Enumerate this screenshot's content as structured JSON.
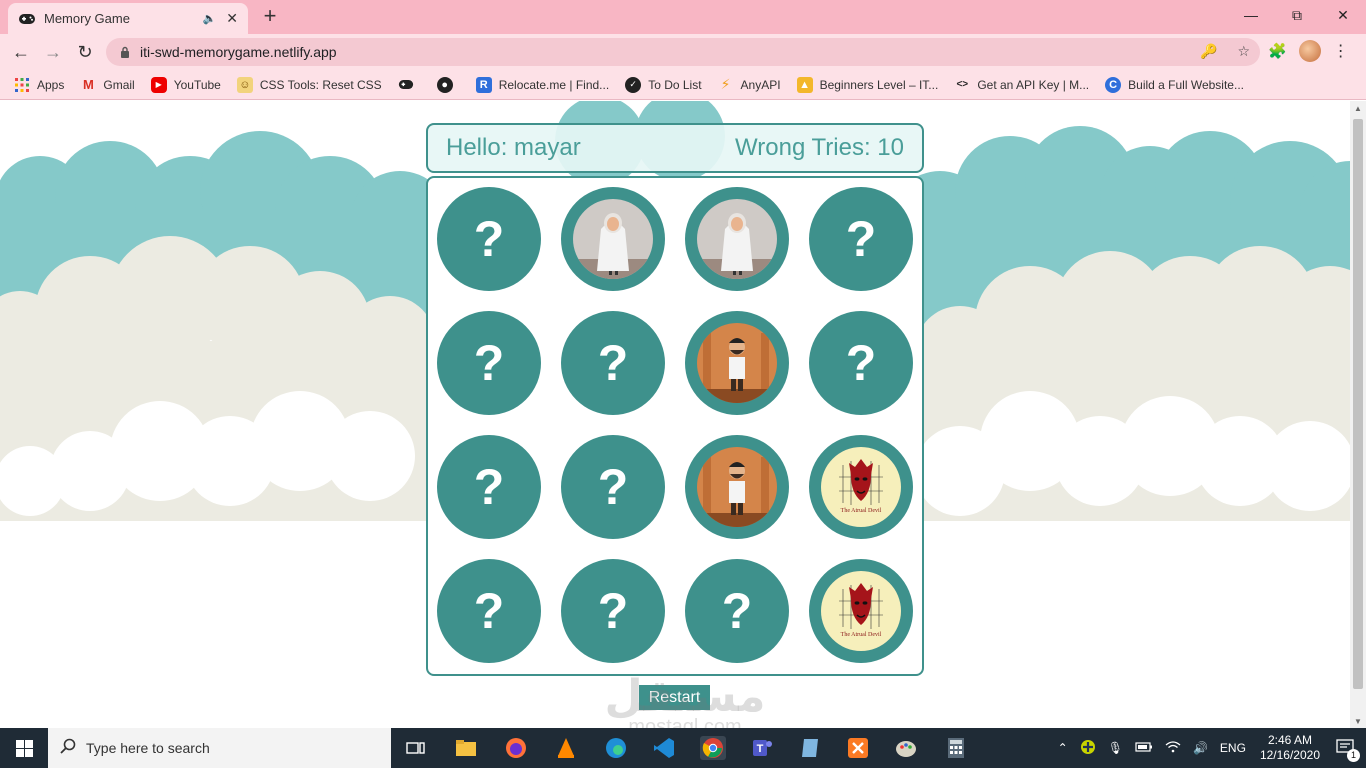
{
  "browser": {
    "tab_title": "Memory Game",
    "url": "iti-swd-memorygame.netlify.app",
    "new_tab_symbol": "+",
    "bookmarks": [
      {
        "label": "Apps",
        "icon": "apps-grid-icon"
      },
      {
        "label": "Gmail",
        "icon": "gmail-icon"
      },
      {
        "label": "YouTube",
        "icon": "youtube-icon"
      },
      {
        "label": "CSS Tools: Reset CSS",
        "icon": "css-tools-icon"
      },
      {
        "label": "",
        "icon": "gamepad-icon"
      },
      {
        "label": "",
        "icon": "globe-icon"
      },
      {
        "label": "Relocate.me | Find...",
        "icon": "relocate-icon"
      },
      {
        "label": "To Do List",
        "icon": "todo-icon"
      },
      {
        "label": "AnyAPI",
        "icon": "bolt-icon"
      },
      {
        "label": "Beginners Level – IT...",
        "icon": "graduation-icon"
      },
      {
        "label": "Get an API Key | M...",
        "icon": "api-key-icon"
      },
      {
        "label": "Build a Full Website...",
        "icon": "build-website-icon"
      }
    ]
  },
  "game": {
    "greeting": "Hello: mayar",
    "wrong_tries": "Wrong Tries: 10",
    "restart_label": "Restart",
    "hidden_symbol": "?",
    "cards": [
      {
        "state": "hidden"
      },
      {
        "state": "revealed",
        "face": "robed-figure"
      },
      {
        "state": "revealed",
        "face": "robed-figure"
      },
      {
        "state": "hidden"
      },
      {
        "state": "hidden"
      },
      {
        "state": "hidden"
      },
      {
        "state": "revealed",
        "face": "bearded-man"
      },
      {
        "state": "hidden"
      },
      {
        "state": "hidden"
      },
      {
        "state": "hidden"
      },
      {
        "state": "revealed",
        "face": "bearded-man"
      },
      {
        "state": "revealed",
        "face": "devil-mask"
      },
      {
        "state": "hidden"
      },
      {
        "state": "hidden"
      },
      {
        "state": "hidden"
      },
      {
        "state": "revealed",
        "face": "devil-mask"
      }
    ],
    "devil_caption": "The Atrual Devil"
  },
  "watermark": {
    "arabic": "مستقل",
    "latin": "mostaql.com"
  },
  "taskbar": {
    "search_placeholder": "Type here to search",
    "language": "ENG",
    "time": "2:46 AM",
    "date": "12/16/2020",
    "notifications": "1"
  },
  "colors": {
    "teal": "#3e918c",
    "tab_bar": "#f8b6c4",
    "toolbar": "#fde1e7",
    "cloud_teal": "#85c9c9",
    "cloud_cream": "#ecebe2"
  }
}
